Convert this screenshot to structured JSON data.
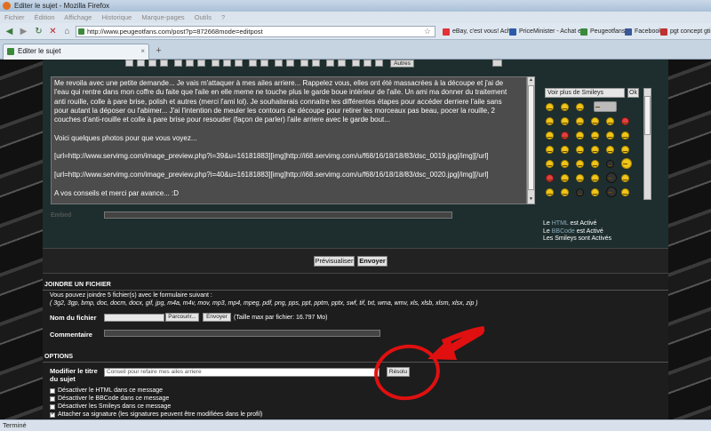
{
  "window": {
    "title": "Editer le sujet - Mozilla Firefox"
  },
  "menu": [
    "Fichier",
    "Édition",
    "Affichage",
    "Historique",
    "Marque-pages",
    "Outils",
    "?"
  ],
  "nav": {
    "url": "http://www.peugeotfans.com/post?p=872668mode=editpost"
  },
  "bookmarks": [
    {
      "label": "eBay, c'est vous! Ach...",
      "color": "#e43137"
    },
    {
      "label": "PriceMinister - Achat e...",
      "color": "#2a5aa8"
    },
    {
      "label": "Peugeotfans",
      "color": "#3a8a3a"
    },
    {
      "label": "Facebook",
      "color": "#3b5998"
    },
    {
      "label": "pgt concept gti",
      "color": "#c03030"
    }
  ],
  "tab": {
    "label": "Editer le sujet"
  },
  "editor": {
    "toolbar_autres": "Autres",
    "message_paragraphs": [
      "Me revoila avec une petite demande... Je vais m'attaquer à mes ailes arriere... Rappelez vous, elles ont été massacrées à la découpe et j'ai de l'eau qui rentre dans mon coffre du faite que l'aile en elle meme ne touche plus le garde boue intérieur de l'aile. Un ami ma donner du traitement anti rouille, colle à pare brise, polish et autres (merci l'ami lol). Je souhaiterais connaitre les différentes étapes pour accéder derriere l'aile sans pour autant la déposer ou l'abimer... J'ai l'intention de meuler les contours de découpe pour retirer les morceaux pas beau, pocer la rouille, 2 couches d'anti-rouille et colle à pare brise pour resouder (façon de parler) l'aile arriere avec le garde bout...",
      "Voici quelques photos pour que vous voyez...",
      "[url=http://www.servimg.com/image_preview.php?i=39&u=16181883][img]http://i68.servimg.com/u/f68/16/18/18/83/dsc_0019.jpg[/img][/url]",
      "[url=http://www.servimg.com/image_preview.php?i=40&u=16181883][img]http://i68.servimg.com/u/f68/16/18/18/83/dsc_0020.jpg[/img][/url]",
      "A vos conseils et merci par avance... :D"
    ],
    "smiley_select": "Voir plus de Smileys",
    "smiley_ok": "Ok",
    "embed_label": "Embed",
    "status_html": {
      "prefix": "Le ",
      "link": "HTML",
      "suffix": " est Activé"
    },
    "status_bbcode": {
      "prefix": "Le ",
      "link": "BBCode",
      "suffix": " est Activé"
    },
    "status_smileys": "Les Smileys sont Activés"
  },
  "actions": {
    "preview": "Prévisualiser",
    "send": "Envoyer"
  },
  "attach": {
    "title": "JOINDRE UN FICHIER",
    "info": "Vous pouvez joindre 5 fichier(s) avec le formulaire suivant :",
    "extensions": "( 3g2, 3gp, bmp, doc, docm, docx, gif, jpg, m4a, m4v, mov, mp3, mp4, mpeg, pdf, png, pps, ppt, pptm, pptx, swf, tif, txt, wma, wmv, xls, xlsb, xlsm, xlsx, zip )",
    "filename_label": "Nom du fichier",
    "browse": "Parcourir...",
    "upload": "Envoyer",
    "max_size": "(Taille max par fichier: 16.797 Mo)",
    "comment_label": "Commentaire"
  },
  "options": {
    "title": "OPTIONS",
    "modify_title_label_1": "Modifier le titre",
    "modify_title_label_2": "du sujet",
    "title_value": "Conseil pour refaire mes ailes arriere",
    "resolved": "Résolu",
    "checkboxes": [
      {
        "label": "Désactiver le HTML dans ce message",
        "checked": false
      },
      {
        "label": "Désactiver le BBCode dans ce message",
        "checked": false
      },
      {
        "label": "Désactiver les Smileys dans ce message",
        "checked": false
      },
      {
        "label": "Attacher sa signature (les signatures peuvent être modifiées dans le profil)",
        "checked": true
      }
    ]
  },
  "status_bar": "Terminé",
  "colors": {
    "annotation": "#e01010",
    "panel": "#1e2e2e",
    "brand": "#3a8a3a"
  }
}
